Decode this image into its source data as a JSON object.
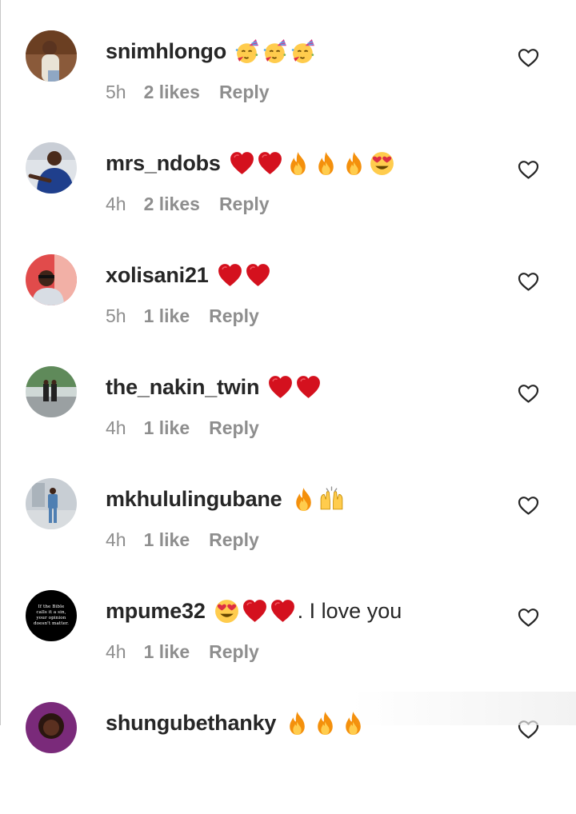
{
  "comments": [
    {
      "username": "snimhlongo",
      "emojis": [
        "partying-face-emoji",
        "partying-face-emoji",
        "partying-face-emoji"
      ],
      "text": "",
      "time": "5h",
      "likes": "2 likes",
      "reply": "Reply",
      "avatar": "avatar-woman-light"
    },
    {
      "username": "mrs_ndobs",
      "emojis": [
        "red-heart-emoji",
        "red-heart-emoji",
        "fire-emoji",
        "fire-emoji",
        "fire-emoji",
        "heart-eyes-emoji"
      ],
      "text": "",
      "time": "4h",
      "likes": "2 likes",
      "reply": "Reply",
      "avatar": "avatar-woman-blue"
    },
    {
      "username": "xolisani21",
      "emojis": [
        "red-heart-emoji",
        "red-heart-emoji"
      ],
      "text": "",
      "time": "5h",
      "likes": "1 like",
      "reply": "Reply",
      "avatar": "avatar-man-red"
    },
    {
      "username": "the_nakin_twin",
      "emojis": [
        "red-heart-emoji",
        "red-heart-emoji"
      ],
      "text": "",
      "time": "4h",
      "likes": "1 like",
      "reply": "Reply",
      "avatar": "avatar-outdoor"
    },
    {
      "username": "mkhululingubane",
      "emojis": [
        "fire-emoji",
        "raising-hands-emoji"
      ],
      "text": "",
      "time": "4h",
      "likes": "1 like",
      "reply": "Reply",
      "avatar": "avatar-man-suit"
    },
    {
      "username": "mpume32",
      "emojis": [
        "heart-eyes-emoji",
        "red-heart-emoji",
        "red-heart-emoji"
      ],
      "text": ". I love you",
      "time": "4h",
      "likes": "1 like",
      "reply": "Reply",
      "avatar": "avatar-black-text",
      "avatar_text": [
        "If the Bible",
        "calls it a sin,",
        "your opinion",
        "doesn't matter."
      ]
    },
    {
      "username": "shungubethanky",
      "emojis": [
        "fire-emoji",
        "fire-emoji",
        "fire-emoji"
      ],
      "text": "",
      "time": "",
      "likes": "",
      "reply": "",
      "avatar": "avatar-woman-dark"
    }
  ],
  "colors": {
    "heart_outline": "#262626",
    "meta": "#8e8e8e",
    "text": "#262626"
  }
}
